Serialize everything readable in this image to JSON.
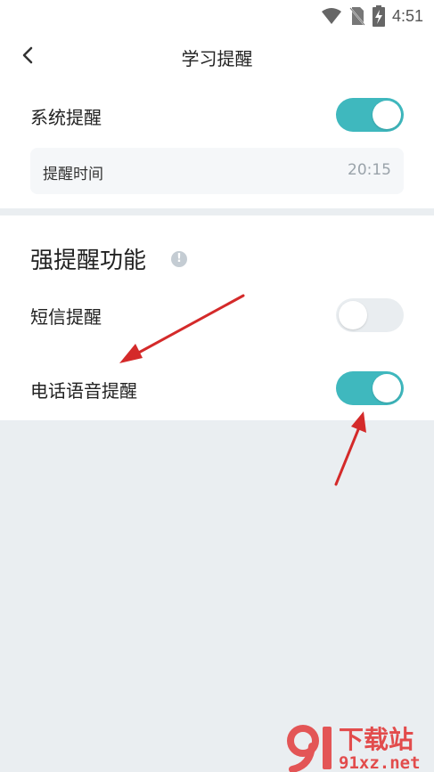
{
  "status_bar": {
    "time": "4:51",
    "icons": [
      "wifi-icon",
      "no-sim-icon",
      "battery-charging-icon"
    ]
  },
  "header": {
    "title": "学习提醒",
    "back_icon": "chevron-left-icon"
  },
  "system_reminder": {
    "label": "系统提醒",
    "enabled": true,
    "time_label": "提醒时间",
    "time_value": "20:15"
  },
  "strong_reminder": {
    "title": "强提醒功能",
    "info_icon": "info-icon",
    "items": [
      {
        "label": "短信提醒",
        "enabled": false
      },
      {
        "label": "电话语音提醒",
        "enabled": true
      }
    ]
  },
  "colors": {
    "accent": "#3fb8be",
    "switch_off": "#e9edf0",
    "annotation_arrow": "#d42a2a"
  },
  "watermark": {
    "text1": "下载站",
    "text2": "91xz.net"
  }
}
